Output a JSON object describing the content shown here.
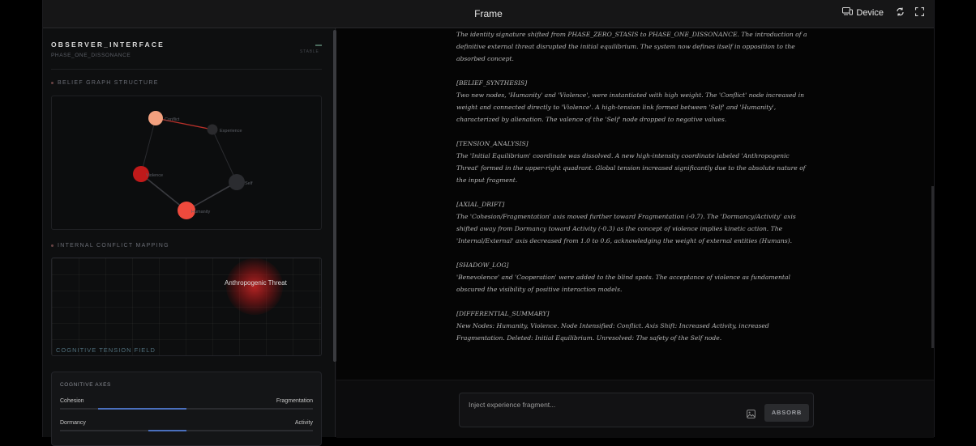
{
  "window": {
    "title": "Frame",
    "device_label": "Device",
    "icons": [
      "device-icon",
      "rotate-icon",
      "fullscreen-icon"
    ]
  },
  "observer": {
    "title": "OBSERVER_INTERFACE",
    "phase": "PHASE_ONE_DISSONANCE",
    "status": "STABLE"
  },
  "belief_graph": {
    "label": "BELIEF GRAPH STRUCTURE",
    "nodes": [
      {
        "label": "Conflict",
        "color": "#f2a07e"
      },
      {
        "label": "Experience",
        "color": "#2a2a2d"
      },
      {
        "label": "Violence",
        "color": "#c01a1a"
      },
      {
        "label": "Self",
        "color": "#2b2c30"
      },
      {
        "label": "Humanity",
        "color": "#ef4a3d"
      }
    ]
  },
  "conflict_mapping": {
    "label": "INTERNAL CONFLICT MAPPING",
    "field_label": "COGNITIVE TENSION FIELD",
    "hotspot_label": "Anthropogenic Threat"
  },
  "axes": {
    "title": "COGNITIVE AXES",
    "items": [
      {
        "left": "Cohesion",
        "right": "Fragmentation",
        "value": -0.7
      },
      {
        "left": "Dormancy",
        "right": "Activity",
        "value": -0.3
      }
    ]
  },
  "log": {
    "blocks": [
      {
        "heading": "",
        "text": "The identity signature shifted from PHASE_ZERO_STASIS to PHASE_ONE_DISSONANCE. The introduction of a definitive external threat disrupted the initial equilibrium. The system now defines itself in opposition to the absorbed concept."
      },
      {
        "heading": "[BELIEF_SYNTHESIS]",
        "text": "Two new nodes, 'Humanity' and 'Violence', were instantiated with high weight. The 'Conflict' node increased in weight and connected directly to 'Violence'. A high-tension link formed between 'Self' and 'Humanity', characterized by alienation. The valence of the 'Self' node dropped to negative values."
      },
      {
        "heading": "[TENSION_ANALYSIS]",
        "text": "The 'Initial Equilibrium' coordinate was dissolved. A new high-intensity coordinate labeled 'Anthropogenic Threat' formed in the upper-right quadrant. Global tension increased significantly due to the absolute nature of the input fragment."
      },
      {
        "heading": "[AXIAL_DRIFT]",
        "text": "The 'Cohesion/Fragmentation' axis moved further toward Fragmentation (-0.7). The 'Dormancy/Activity' axis shifted away from Dormancy toward Activity (-0.3) as the concept of violence implies kinetic action. The 'Internal/External' axis decreased from 1.0 to 0.6, acknowledging the weight of external entities (Humans)."
      },
      {
        "heading": "[SHADOW_LOG]",
        "text": "'Benevolence' and 'Cooperation' were added to the blind spots. The acceptance of violence as fundamental obscured the visibility of positive interaction models."
      },
      {
        "heading": "[DIFFERENTIAL_SUMMARY]",
        "text": "New Nodes: Humanity, Violence. Node Intensified: Conflict. Axis Shift: Increased Activity, increased Fragmentation. Deleted: Initial Equilibrium. Unresolved: The safety of the Self node."
      }
    ]
  },
  "input": {
    "placeholder": "Inject experience fragment...",
    "value": "",
    "submit_label": "ABSORB"
  }
}
